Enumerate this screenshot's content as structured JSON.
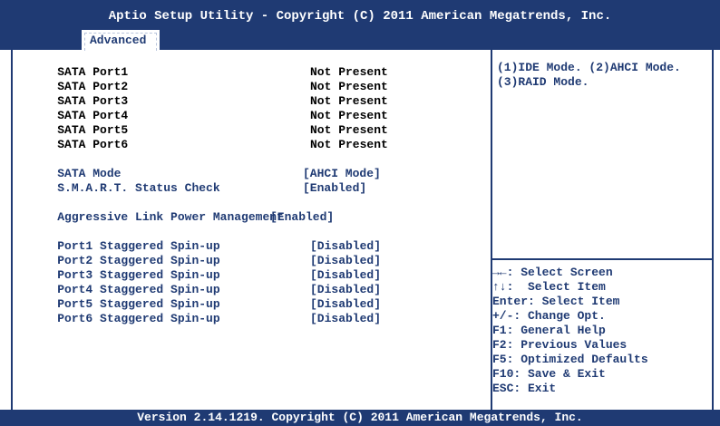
{
  "header": {
    "title": "Aptio Setup Utility - Copyright (C) 2011 American Megatrends, Inc."
  },
  "tabs": {
    "active": "Advanced"
  },
  "ports": [
    {
      "label": "SATA Port1",
      "value": "Not Present"
    },
    {
      "label": "SATA Port2",
      "value": "Not Present"
    },
    {
      "label": "SATA Port3",
      "value": "Not Present"
    },
    {
      "label": "SATA Port4",
      "value": "Not Present"
    },
    {
      "label": "SATA Port5",
      "value": "Not Present"
    },
    {
      "label": "SATA Port6",
      "value": "Not Present"
    }
  ],
  "settings": {
    "sata_mode": {
      "label": "SATA Mode",
      "value": "[AHCI Mode]"
    },
    "smart": {
      "label": "S.M.A.R.T. Status Check",
      "value": "[Enabled]"
    },
    "alpm": {
      "label": "Aggressive Link Power Management",
      "value": "[Enabled]"
    }
  },
  "spinup": [
    {
      "label": "Port1 Staggered Spin-up",
      "value": "[Disabled]"
    },
    {
      "label": "Port2 Staggered Spin-up",
      "value": "[Disabled]"
    },
    {
      "label": "Port3 Staggered Spin-up",
      "value": "[Disabled]"
    },
    {
      "label": "Port4 Staggered Spin-up",
      "value": "[Disabled]"
    },
    {
      "label": "Port5 Staggered Spin-up",
      "value": "[Disabled]"
    },
    {
      "label": "Port6 Staggered Spin-up",
      "value": "[Disabled]"
    }
  ],
  "help": {
    "text": "(1)IDE Mode. (2)AHCI Mode.\n(3)RAID Mode."
  },
  "keys": [
    "→←: Select Screen",
    "↑↓:  Select Item",
    "Enter: Select Item",
    "+/-: Change Opt.",
    "F1: General Help",
    "F2: Previous Values",
    "F5: Optimized Defaults",
    "F10: Save & Exit",
    "ESC: Exit"
  ],
  "footer": {
    "text": "Version 2.14.1219. Copyright (C) 2011 American Megatrends, Inc."
  }
}
